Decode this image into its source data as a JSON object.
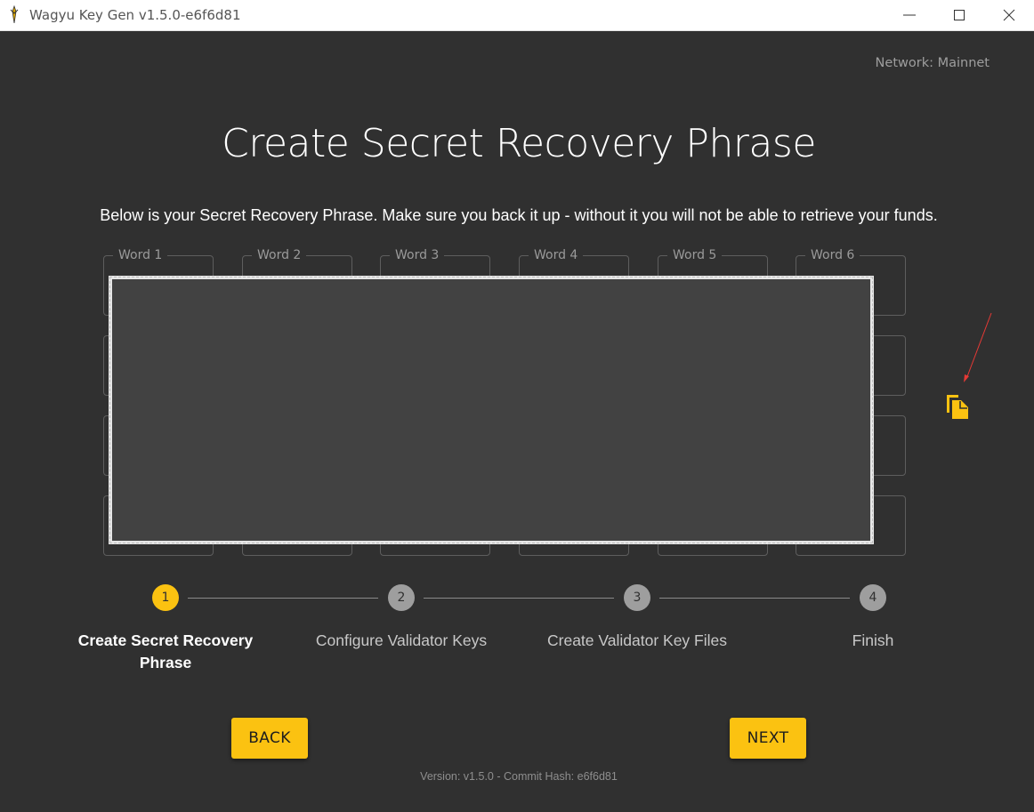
{
  "window": {
    "title": "Wagyu Key Gen v1.5.0-e6f6d81"
  },
  "network_label": "Network: Mainnet",
  "page_title": "Create Secret Recovery Phrase",
  "instructions": "Below is your Secret Recovery Phrase. Make sure you back it up - without it you will not be able to retrieve your funds.",
  "word_labels": [
    "Word 1",
    "Word 2",
    "Word 3",
    "Word 4",
    "Word 5",
    "Word 6"
  ],
  "copy_icon": "copy-icon",
  "stepper": {
    "steps": [
      {
        "number": "1",
        "label": "Create Secret Recovery Phrase",
        "active": true
      },
      {
        "number": "2",
        "label": "Configure Validator Keys",
        "active": false
      },
      {
        "number": "3",
        "label": "Create Validator Key Files",
        "active": false
      },
      {
        "number": "4",
        "label": "Finish",
        "active": false
      }
    ]
  },
  "buttons": {
    "back": "BACK",
    "next": "NEXT"
  },
  "version_text": "Version: v1.5.0 - Commit Hash: e6f6d81",
  "colors": {
    "background": "#303030",
    "accent": "#fbc211",
    "annotation": "#e53935"
  }
}
